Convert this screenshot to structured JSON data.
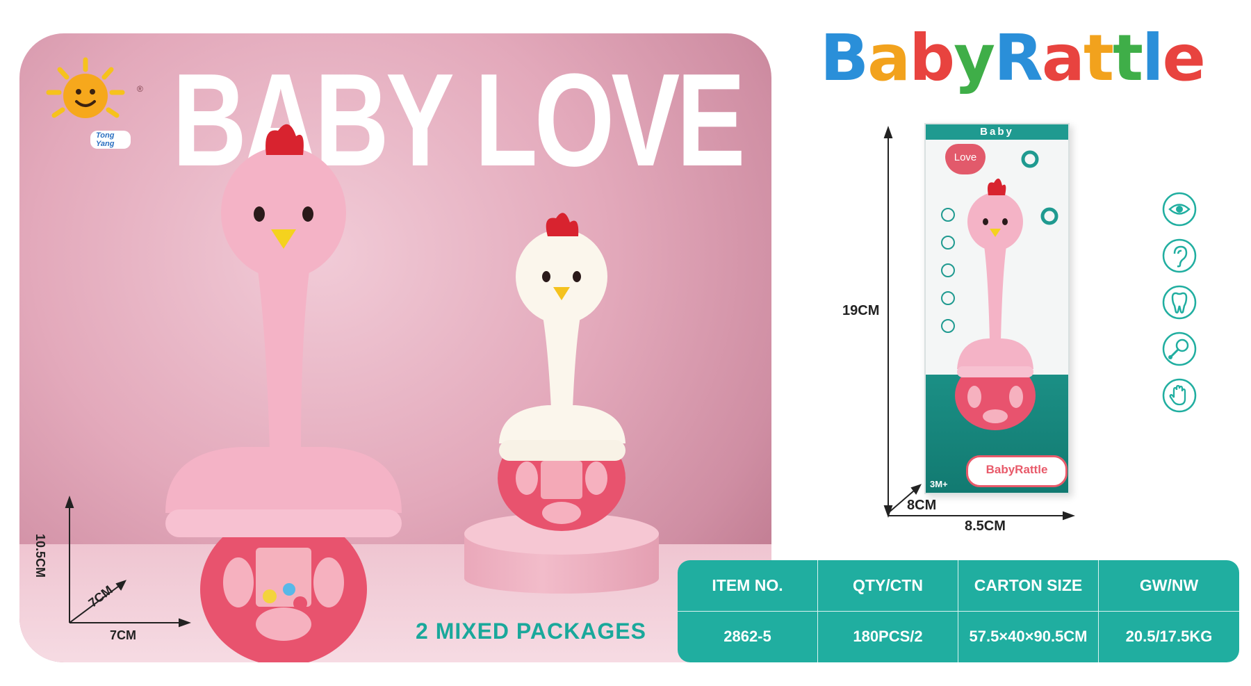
{
  "brand": {
    "logo_name": "Tong Yang",
    "registered_mark": "®"
  },
  "headline": "BABY LOVE",
  "product_title": {
    "letters": [
      {
        "ch": "B",
        "color": "#2a8fd9"
      },
      {
        "ch": "a",
        "color": "#f2a21d"
      },
      {
        "ch": "b",
        "color": "#e8433f"
      },
      {
        "ch": "y",
        "color": "#3fae48"
      },
      {
        "ch": "R",
        "color": "#2a8fd9"
      },
      {
        "ch": "a",
        "color": "#e8433f"
      },
      {
        "ch": "t",
        "color": "#f2a21d"
      },
      {
        "ch": "t",
        "color": "#3fae48"
      },
      {
        "ch": "l",
        "color": "#2a8fd9"
      },
      {
        "ch": "e",
        "color": "#e8433f"
      }
    ]
  },
  "packaging_note": "2 MIXED PACKAGES",
  "product_dims": {
    "height": "10.5CM",
    "depth": "7CM",
    "width": "7CM"
  },
  "box": {
    "top_label": "Baby",
    "love_label": "Love",
    "logo_text": "BabyRattle",
    "age": "3M+",
    "height": "19CM",
    "depth": "8CM",
    "width": "8.5CM"
  },
  "features": [
    {
      "icon": "eye-icon"
    },
    {
      "icon": "ear-icon"
    },
    {
      "icon": "tooth-icon"
    },
    {
      "icon": "rattle-icon"
    },
    {
      "icon": "hand-icon"
    }
  ],
  "spec_table": {
    "headers": [
      "ITEM NO.",
      "QTY/CTN",
      "CARTON SIZE",
      "GW/NW"
    ],
    "values": [
      "2862-5",
      "180PCS/2",
      "57.5×40×90.5CM",
      "20.5/17.5KG"
    ]
  },
  "colors": {
    "accent_teal": "#20aea0",
    "pink_rattle": "#f4b3c6",
    "ball_red": "#e8536e"
  }
}
